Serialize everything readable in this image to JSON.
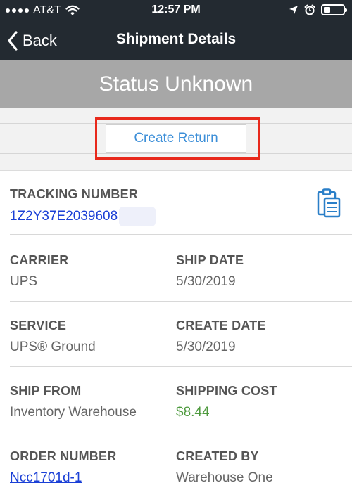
{
  "status_bar": {
    "carrier": "AT&T",
    "time": "12:57 PM",
    "battery_level": 0.35
  },
  "nav": {
    "back_label": "Back",
    "title": "Shipment Details"
  },
  "banner": {
    "status": "Status Unknown"
  },
  "actions": {
    "create_return_label": "Create Return"
  },
  "details": {
    "tracking_label": "TRACKING NUMBER",
    "tracking_value": "1Z2Y37E2039608",
    "carrier_label": "CARRIER",
    "carrier_value": "UPS",
    "ship_date_label": "SHIP DATE",
    "ship_date_value": "5/30/2019",
    "service_label": "SERVICE",
    "service_value": "UPS® Ground",
    "create_date_label": "CREATE DATE",
    "create_date_value": "5/30/2019",
    "ship_from_label": "SHIP FROM",
    "ship_from_value": "Inventory Warehouse",
    "shipping_cost_label": "SHIPPING COST",
    "shipping_cost_value": "$8.44",
    "order_number_label": "ORDER NUMBER",
    "order_number_value": "Ncc1701d-1",
    "created_by_label": "CREATED BY",
    "created_by_value": "Warehouse One"
  },
  "colors": {
    "header": "#232a31",
    "banner": "#a7a7a7",
    "highlight": "#e8291c",
    "link": "#1a3fd6",
    "button_text": "#3d8fd8",
    "cost": "#4e9a3e",
    "icon": "#2a7fc8"
  }
}
